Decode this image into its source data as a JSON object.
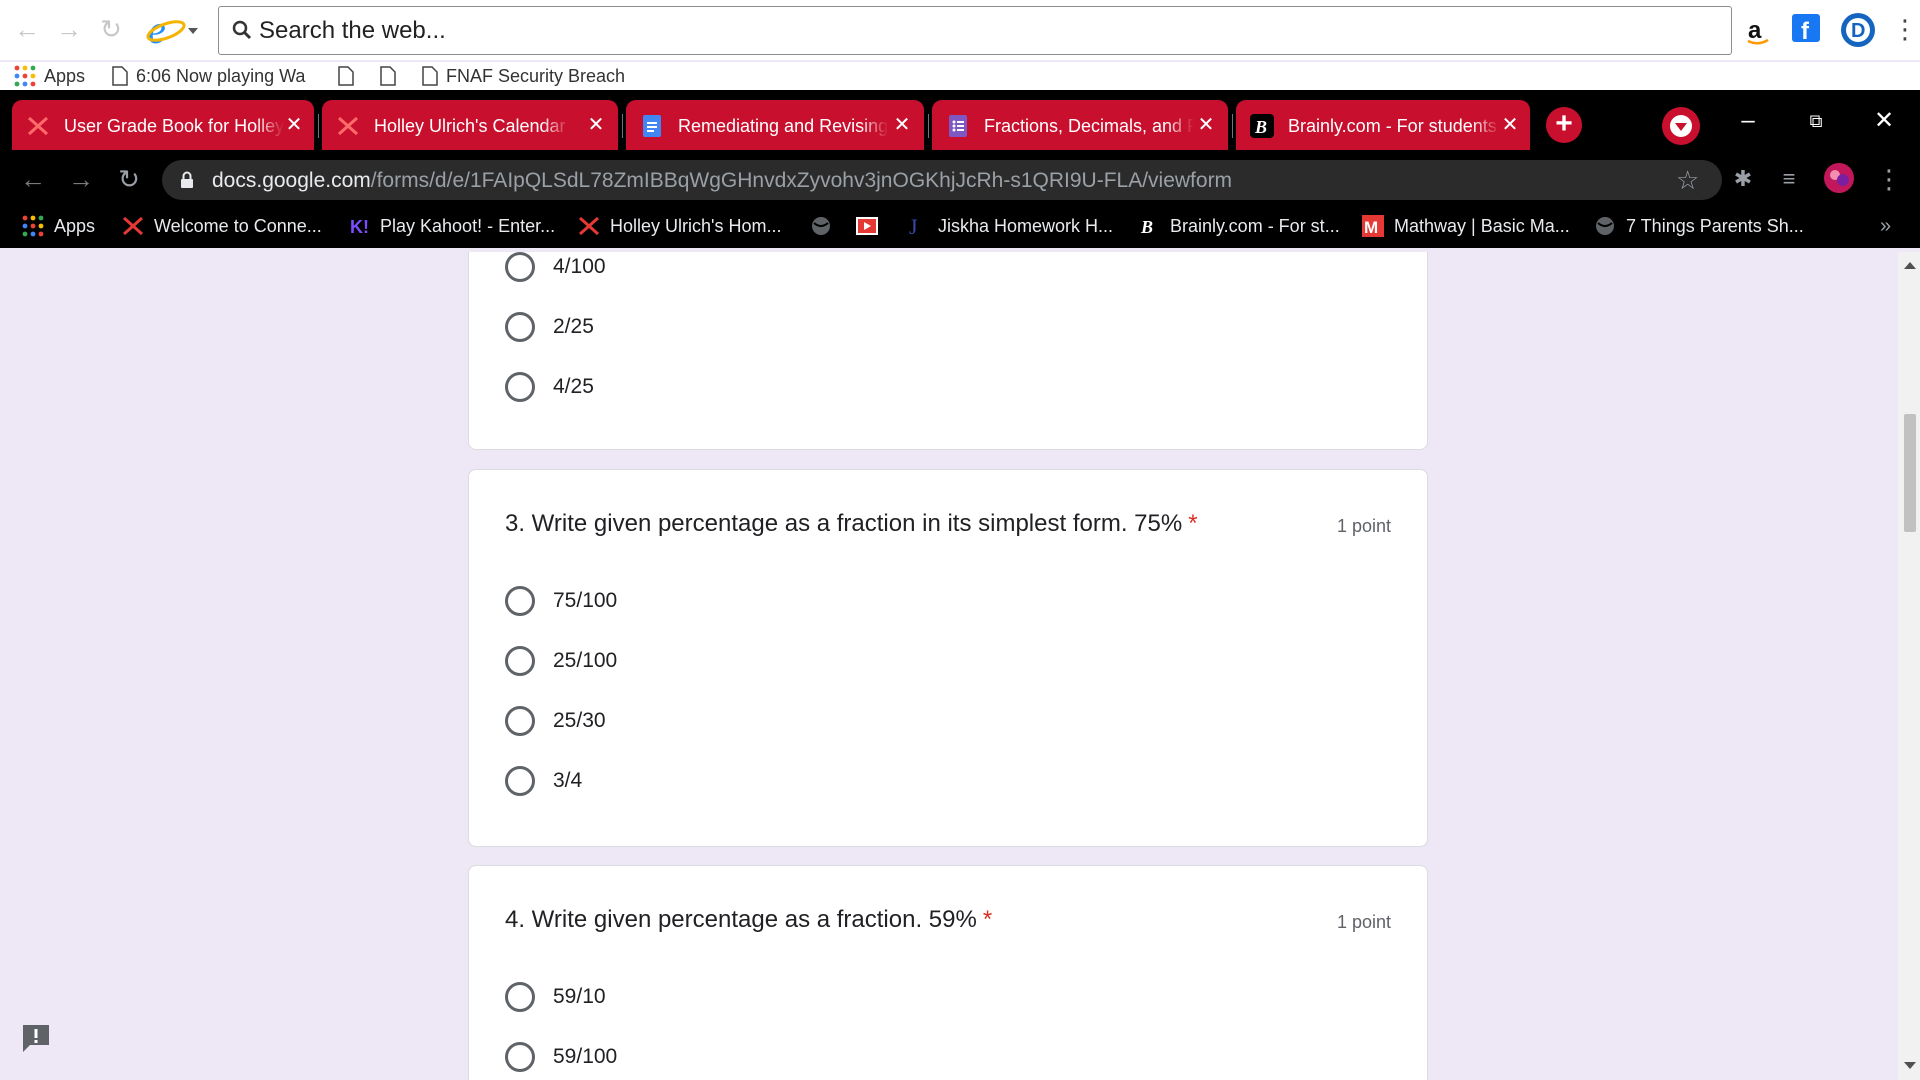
{
  "outer_browser": {
    "search_placeholder": "Search the web...",
    "bookmarks": [
      {
        "label": "Apps",
        "icon": "apps-grid-icon"
      },
      {
        "label": "6:06 Now playing Wa",
        "icon": "page-icon"
      },
      {
        "label": "",
        "icon": "page-icon"
      },
      {
        "label": "",
        "icon": "page-icon"
      },
      {
        "label": "FNAF Security Breach",
        "icon": "page-icon"
      }
    ],
    "profile_initial": "D"
  },
  "tabs": [
    {
      "title": "User Grade Book for Holley Ulrich",
      "icon": "red-x-logo-icon"
    },
    {
      "title": "Holley Ulrich's Calendar",
      "icon": "red-x-logo-icon"
    },
    {
      "title": "Remediating and Revising",
      "icon": "google-docs-icon"
    },
    {
      "title": "Fractions, Decimals, and Percents",
      "icon": "google-forms-icon"
    },
    {
      "title": "Brainly.com - For students",
      "icon": "brainly-icon"
    }
  ],
  "address_bar": {
    "host": "docs.google.com",
    "path": "/forms/d/e/1FAIpQLSdL78ZmIBBqWgGHnvdxZyvohv3jnOGKhjJcRh-s1QRI9U-FLA/viewform"
  },
  "bookmarks_bar": [
    {
      "label": "Apps",
      "icon": "apps-grid-icon"
    },
    {
      "label": "Welcome to Conne...",
      "icon": "red-x-logo-icon"
    },
    {
      "label": "Play Kahoot! - Enter...",
      "icon": "kahoot-icon"
    },
    {
      "label": "Holley Ulrich's Hom...",
      "icon": "red-x-logo-icon"
    },
    {
      "label": "",
      "icon": "globe-icon"
    },
    {
      "label": "",
      "icon": "youtube-icon"
    },
    {
      "label": "Jiskha Homework H...",
      "icon": "jiskha-icon"
    },
    {
      "label": "Brainly.com - For st...",
      "icon": "brainly-icon"
    },
    {
      "label": "Mathway | Basic Ma...",
      "icon": "mathway-icon"
    },
    {
      "label": "7 Things Parents Sh...",
      "icon": "globe-icon"
    }
  ],
  "form": {
    "q2_options_visible": [
      "4/100",
      "2/25",
      "4/25"
    ],
    "questions": [
      {
        "title": "3. Write given percentage as a fraction in its simplest form. 75%",
        "required_mark": "*",
        "points": "1 point",
        "options": [
          "75/100",
          "25/100",
          "25/30",
          "3/4"
        ]
      },
      {
        "title": "4. Write given percentage as a fraction. 59%",
        "required_mark": "*",
        "points": "1 point",
        "options": [
          "59/10",
          "59/100"
        ]
      }
    ]
  },
  "colors": {
    "tab_red": "#c8102e",
    "page_bg": "#ede7f6",
    "required_red": "#d93025"
  }
}
